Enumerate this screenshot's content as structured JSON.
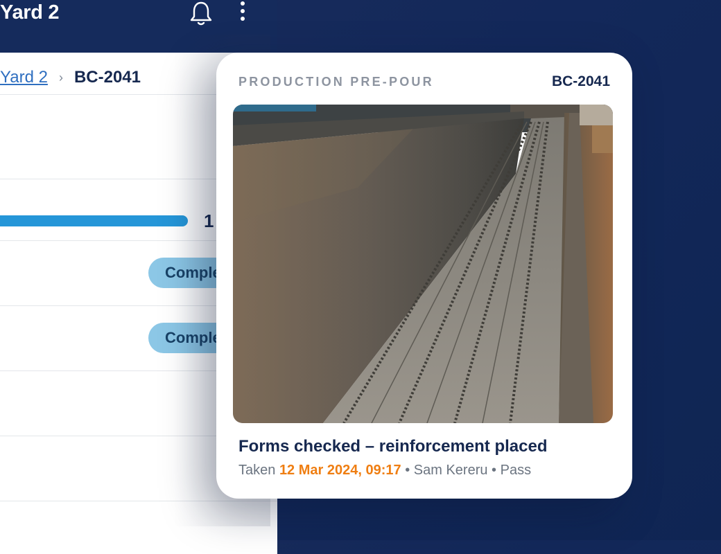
{
  "app": {
    "title": "Yard 2",
    "icons": {
      "notifications": "bell-icon",
      "menu": "kebab-menu-icon"
    }
  },
  "breadcrumb": {
    "parent": "Yard 2",
    "separator": "›",
    "current": "BC-2041"
  },
  "progress": {
    "label_partial": "1",
    "fraction_visible": 1.0
  },
  "status_pills": [
    "Comple",
    "Comple"
  ],
  "card": {
    "eyebrow": "PRODUCTION PRE-POUR",
    "code": "BC-2041",
    "caption": "Forms checked – reinforcement placed",
    "meta": {
      "prefix": "Taken",
      "timestamp": "12 Mar 2024, 09:17",
      "sep1": "•",
      "author": "Sam Kereru",
      "sep2": "•",
      "result": "Pass"
    }
  },
  "colors": {
    "background": "#13285a",
    "accent_blue": "#2596d8",
    "pill": "#8cc7e6",
    "timestamp": "#ef7e12",
    "navy_text": "#16284f"
  }
}
